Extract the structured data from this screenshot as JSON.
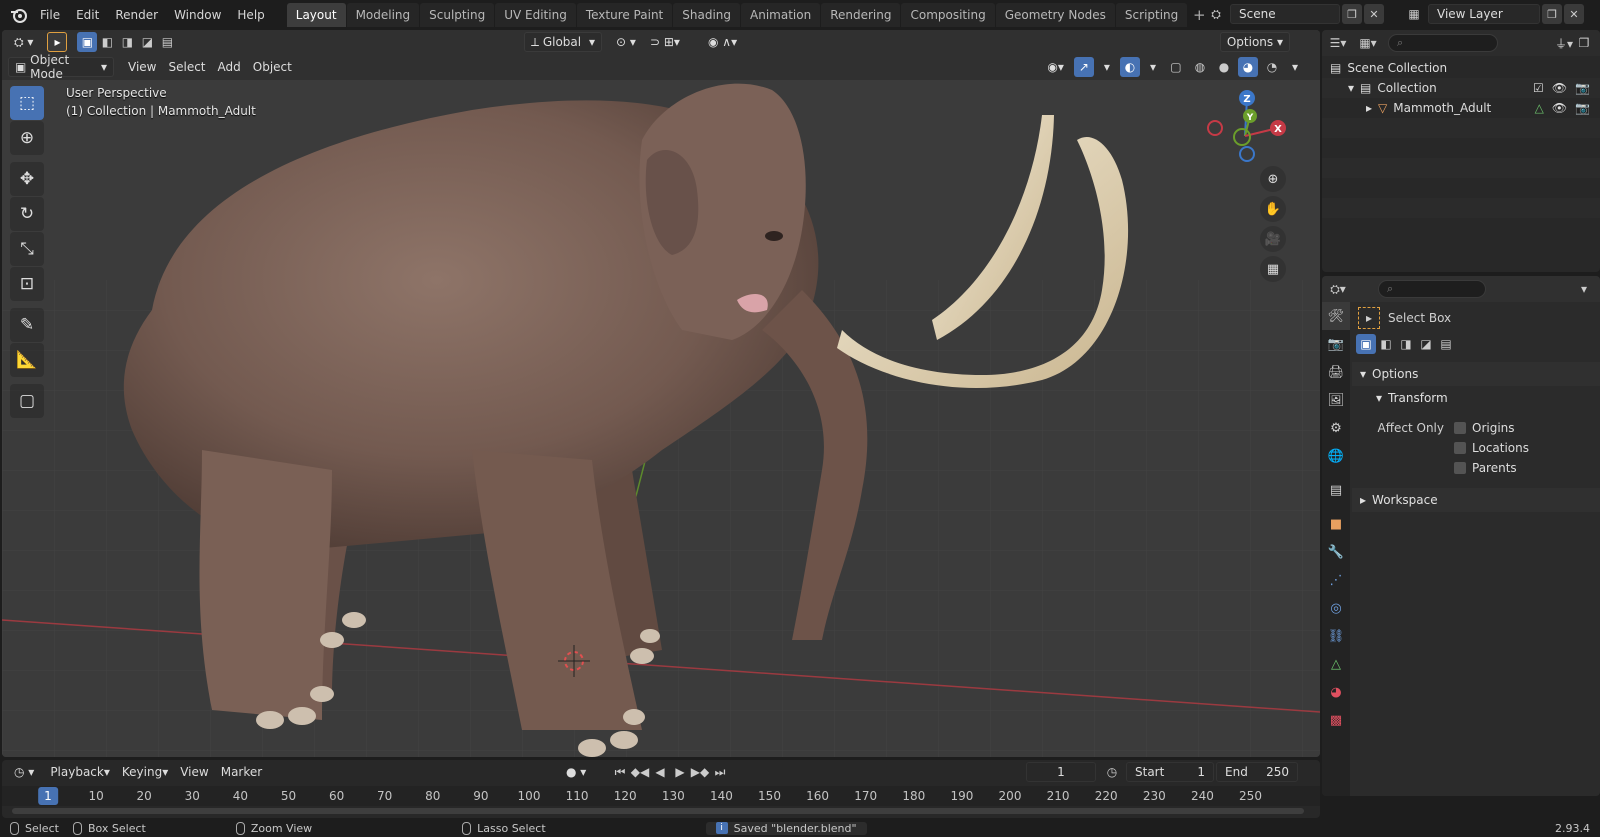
{
  "menu": [
    "File",
    "Edit",
    "Render",
    "Window",
    "Help"
  ],
  "workspaces": [
    "Layout",
    "Modeling",
    "Sculpting",
    "UV Editing",
    "Texture Paint",
    "Shading",
    "Animation",
    "Rendering",
    "Compositing",
    "Geometry Nodes",
    "Scripting"
  ],
  "active_workspace": "Layout",
  "scene": "Scene",
  "view_layer": "View Layer",
  "viewport": {
    "transform_orientation": "Global",
    "options_label": "Options",
    "mode": "Object Mode",
    "menus": [
      "View",
      "Select",
      "Add",
      "Object"
    ],
    "overlay_line1": "User Perspective",
    "overlay_line2": "(1) Collection | Mammoth_Adult",
    "gizmo": {
      "z": "Z",
      "y": "Y",
      "x": "X"
    }
  },
  "outliner": {
    "scene_collection": "Scene Collection",
    "collection": "Collection",
    "object": "Mammoth_Adult"
  },
  "properties": {
    "tool_name": "Select Box",
    "options_label": "Options",
    "transform_label": "Transform",
    "affect_only_label": "Affect Only",
    "checks": [
      "Origins",
      "Locations",
      "Parents"
    ],
    "workspace_label": "Workspace"
  },
  "timeline": {
    "menus": [
      "Playback",
      "Keying",
      "View",
      "Marker"
    ],
    "current_frame": "1",
    "start_label": "Start",
    "start_value": "1",
    "end_label": "End",
    "end_value": "250",
    "ticks": [
      "1",
      "10",
      "20",
      "30",
      "40",
      "50",
      "60",
      "70",
      "80",
      "90",
      "100",
      "110",
      "120",
      "130",
      "140",
      "150",
      "160",
      "170",
      "180",
      "190",
      "200",
      "210",
      "220",
      "230",
      "240",
      "250"
    ]
  },
  "status": {
    "select": "Select",
    "box_select": "Box Select",
    "zoom_view": "Zoom View",
    "lasso_select": "Lasso Select",
    "message": "Saved \"blender.blend\"",
    "version": "2.93.4"
  },
  "colors": {
    "accent": "#4772b3",
    "x_axis": "#c63a46",
    "y_axis": "#6b9e2b",
    "z_axis": "#3b77c9"
  }
}
